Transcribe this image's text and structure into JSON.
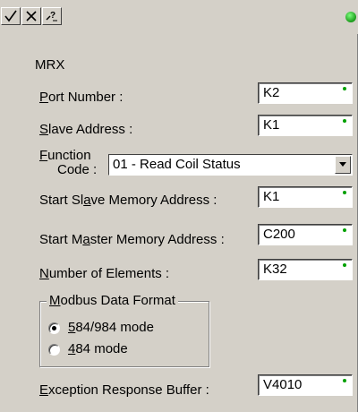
{
  "toolbar": {
    "buttons": [
      {
        "icon": "check-icon"
      },
      {
        "icon": "x-icon"
      },
      {
        "icon": "help-icon"
      }
    ],
    "status_color": "#22c322"
  },
  "title": "MRX",
  "fields": {
    "port_number": {
      "label_u": "P",
      "label_rest": "ort Number :",
      "value": "K2"
    },
    "slave_address": {
      "label_u": "S",
      "label_rest": "lave Address :",
      "value": "K1"
    },
    "function_code": {
      "label_line1_u": "F",
      "label_line1_rest": "unction",
      "label_line2": "Code :",
      "value": "01 - Read Coil Status"
    },
    "start_slave": {
      "label_pre": "Start Sl",
      "label_u": "a",
      "label_rest": "ve Memory Address :",
      "value": "K1"
    },
    "start_master": {
      "label_pre": "Start M",
      "label_u": "a",
      "label_rest": "ster Memory Address :",
      "value": "C200"
    },
    "num_elements": {
      "label_u": "N",
      "label_rest": "umber of Elements :",
      "value": "K32"
    },
    "exception_buffer": {
      "label_u": "E",
      "label_rest": "xception Response Buffer :",
      "value": "V4010"
    }
  },
  "modbus_format": {
    "group_label_u": "M",
    "group_label_rest": "odbus Data Format",
    "options": [
      {
        "label_u": "5",
        "label_rest": "84/984 mode",
        "selected": true
      },
      {
        "label_u": "4",
        "label_rest": "84 mode",
        "selected": false
      }
    ]
  }
}
